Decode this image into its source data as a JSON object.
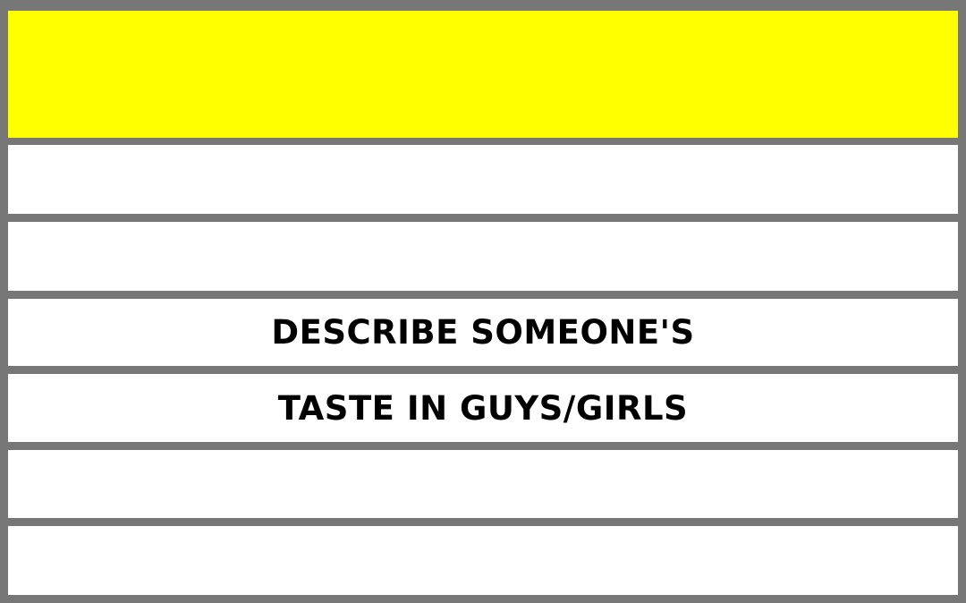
{
  "header": {
    "color": "#ffff00"
  },
  "rows": [
    {
      "text": ""
    },
    {
      "text": ""
    },
    {
      "text": "DESCRIBE SOMEONE'S"
    },
    {
      "text": "TASTE IN GUYS/GIRLS"
    },
    {
      "text": ""
    },
    {
      "text": ""
    }
  ],
  "colors": {
    "border": "#777777",
    "row_background": "#ffffff",
    "text": "#000000"
  }
}
